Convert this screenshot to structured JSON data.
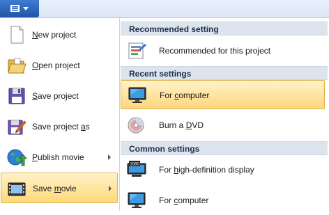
{
  "app_menu": {
    "button_icon": "menu-icon",
    "caret_icon": "caret-down-icon"
  },
  "left_menu": [
    {
      "pre": "",
      "mn": "N",
      "post": "ew project",
      "icon": "new-project-icon",
      "submenu": false
    },
    {
      "pre": "",
      "mn": "O",
      "post": "pen project",
      "icon": "open-project-icon",
      "submenu": false
    },
    {
      "pre": "",
      "mn": "S",
      "post": "ave project",
      "icon": "save-project-icon",
      "submenu": false
    },
    {
      "pre": "Save project ",
      "mn": "a",
      "post": "s",
      "icon": "save-project-as-icon",
      "submenu": false
    },
    {
      "pre": "",
      "mn": "P",
      "post": "ublish movie",
      "icon": "publish-movie-icon",
      "submenu": true
    },
    {
      "pre": "Save ",
      "mn": "m",
      "post": "ovie",
      "icon": "save-movie-icon",
      "submenu": true,
      "selected": true
    }
  ],
  "right_menu": {
    "recommended": {
      "header": "Recommended setting",
      "items": [
        {
          "pre": "Recommended for this project",
          "mn": "",
          "post": "",
          "icon": "recommended-settings-icon"
        }
      ]
    },
    "recent": {
      "header": "Recent settings",
      "items": [
        {
          "pre": "For ",
          "mn": "c",
          "post": "omputer",
          "icon": "computer-monitor-icon",
          "selected": true
        },
        {
          "pre": "Burn a ",
          "mn": "D",
          "post": "VD",
          "icon": "dvd-disc-icon"
        }
      ]
    },
    "common": {
      "header": "Common settings",
      "items": [
        {
          "pre": "For ",
          "mn": "h",
          "post": "igh-definition display",
          "icon": "hd-display-icon",
          "badge": "1080"
        },
        {
          "pre": "For ",
          "mn": "c",
          "post": "omputer",
          "icon": "computer-monitor-icon"
        }
      ]
    }
  }
}
